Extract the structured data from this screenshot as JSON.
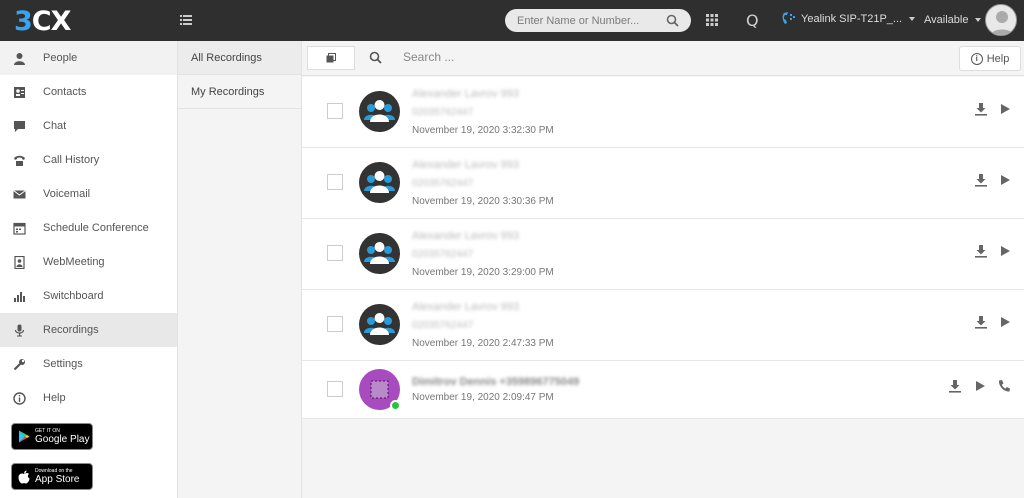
{
  "topbar": {
    "logo_3": "3",
    "logo_cx": "CX",
    "search_placeholder": "Enter Name or Number...",
    "q_label": "Q",
    "phone_device": "Yealink SIP-T21P_...",
    "status": "Available"
  },
  "sidebar": {
    "items": [
      {
        "label": "People",
        "icon": "person-icon"
      },
      {
        "label": "Contacts",
        "icon": "contacts-icon"
      },
      {
        "label": "Chat",
        "icon": "chat-icon"
      },
      {
        "label": "Call History",
        "icon": "phone-icon"
      },
      {
        "label": "Voicemail",
        "icon": "envelope-icon"
      },
      {
        "label": "Schedule Conference",
        "icon": "calendar-icon"
      },
      {
        "label": "WebMeeting",
        "icon": "webmeeting-icon"
      },
      {
        "label": "Switchboard",
        "icon": "bar-chart-icon"
      },
      {
        "label": "Recordings",
        "icon": "microphone-icon"
      },
      {
        "label": "Settings",
        "icon": "wrench-icon"
      },
      {
        "label": "Help",
        "icon": "info-icon"
      }
    ],
    "google_play": {
      "small": "GET IT ON",
      "big": "Google Play"
    },
    "app_store": {
      "small": "Download on the",
      "big": "App Store"
    }
  },
  "subnav": {
    "items": [
      {
        "label": "All Recordings"
      },
      {
        "label": "My Recordings"
      }
    ]
  },
  "toolbar": {
    "search_placeholder": "Search ...",
    "help_label": "Help"
  },
  "recordings": [
    {
      "name": "Alexander Lavrov 993",
      "number": "02035762447",
      "date": "November 19, 2020 3:32:30 PM"
    },
    {
      "name": "Alexander Lavrov 993",
      "number": "02035762447",
      "date": "November 19, 2020 3:30:36 PM"
    },
    {
      "name": "Alexander Lavrov 993",
      "number": "02035762447",
      "date": "November 19, 2020 3:29:00 PM"
    },
    {
      "name": "Alexander Lavrov 993",
      "number": "02035762447",
      "date": "November 19, 2020 2:47:33 PM"
    },
    {
      "name": "Dimitrov Dennis +359896775049",
      "date": "November 19, 2020 2:09:47 PM"
    }
  ],
  "colors": {
    "topbar": "#2f2f2f",
    "logo_accent": "#3aa3f0",
    "conference_avatar_bg": "#333333",
    "user_avatar_bg": "#a84bbf",
    "online": "#27c23a"
  }
}
